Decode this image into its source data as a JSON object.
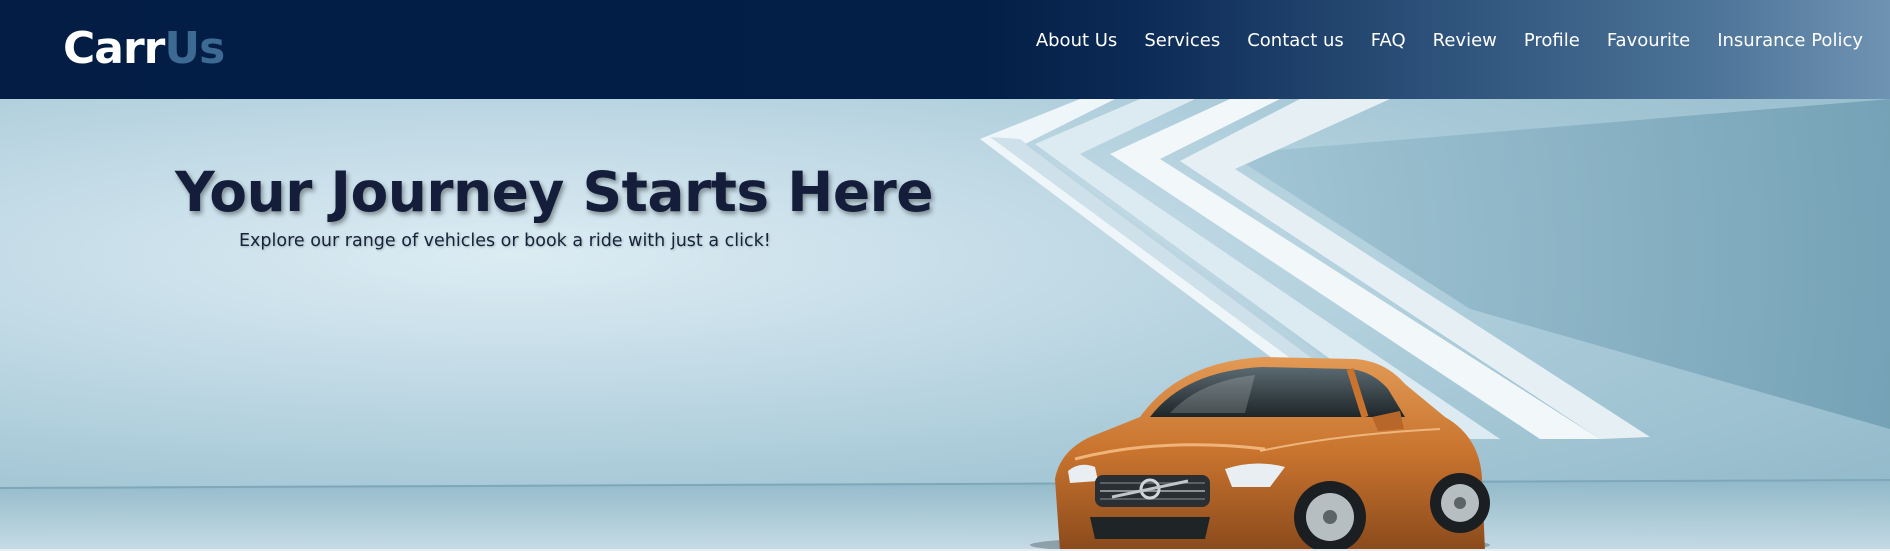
{
  "brand": {
    "part1": "Carr",
    "part2": "Us"
  },
  "nav": {
    "items": [
      {
        "label": "About Us",
        "name": "nav-about-us"
      },
      {
        "label": "Services",
        "name": "nav-services"
      },
      {
        "label": "Contact us",
        "name": "nav-contact-us"
      },
      {
        "label": "FAQ",
        "name": "nav-faq"
      },
      {
        "label": "Review",
        "name": "nav-review"
      },
      {
        "label": "Profile",
        "name": "nav-profile"
      },
      {
        "label": "Favourite",
        "name": "nav-favourite"
      },
      {
        "label": "Insurance Policy",
        "name": "nav-insurance-policy"
      }
    ]
  },
  "hero": {
    "headline": "Your Journey Starts Here",
    "subheadline": "Explore our range of vehicles or book a ride with just a click!"
  },
  "colors": {
    "navbar": "#031f47",
    "brand_accent": "#3d6a92",
    "headline": "#141d3a",
    "hero_background": "#a9cad8",
    "car_body": "#c8732e"
  },
  "icons": {
    "hero_image": "car-illustration"
  }
}
